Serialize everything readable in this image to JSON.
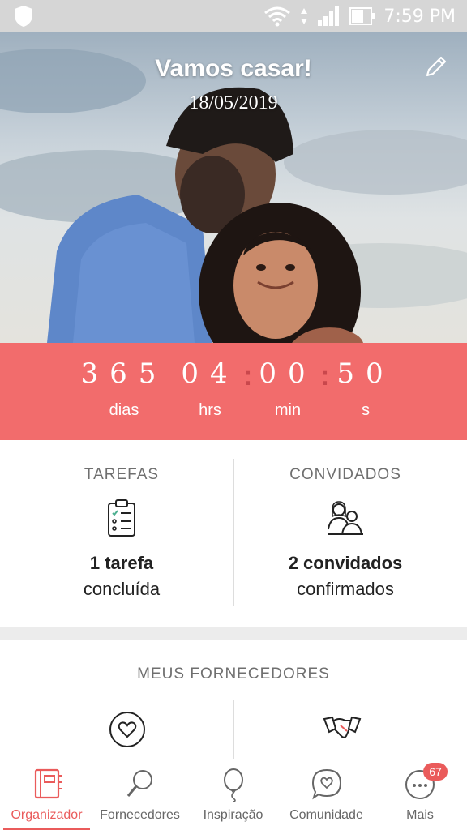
{
  "status_bar": {
    "time": "7:59 PM"
  },
  "hero": {
    "title": "Vamos casar!",
    "date": "18/05/2019"
  },
  "countdown": {
    "days": {
      "value": "365",
      "label": "dias"
    },
    "hours": {
      "value": "04",
      "label": "hrs"
    },
    "minutes": {
      "value": "00",
      "label": "min"
    },
    "seconds": {
      "value": "50",
      "label": "s"
    }
  },
  "tasks": {
    "heading": "TAREFAS",
    "count": "1 tarefa",
    "status": "concluída"
  },
  "guests": {
    "heading": "CONVIDADOS",
    "count": "2 convidados",
    "status": "confirmados"
  },
  "vendors": {
    "heading": "MEUS FORNECEDORES"
  },
  "bottom_nav": {
    "items": [
      {
        "label": "Organizador",
        "icon": "notebook-icon",
        "active": true
      },
      {
        "label": "Fornecedores",
        "icon": "search-icon"
      },
      {
        "label": "Inspiração",
        "icon": "balloon-icon"
      },
      {
        "label": "Comunidade",
        "icon": "chat-heart-icon"
      },
      {
        "label": "Mais",
        "icon": "more-icon",
        "badge": "67"
      }
    ]
  },
  "colors": {
    "accent": "#f26c6c",
    "active_nav": "#ea5b5b",
    "separator": "#c9474c"
  }
}
